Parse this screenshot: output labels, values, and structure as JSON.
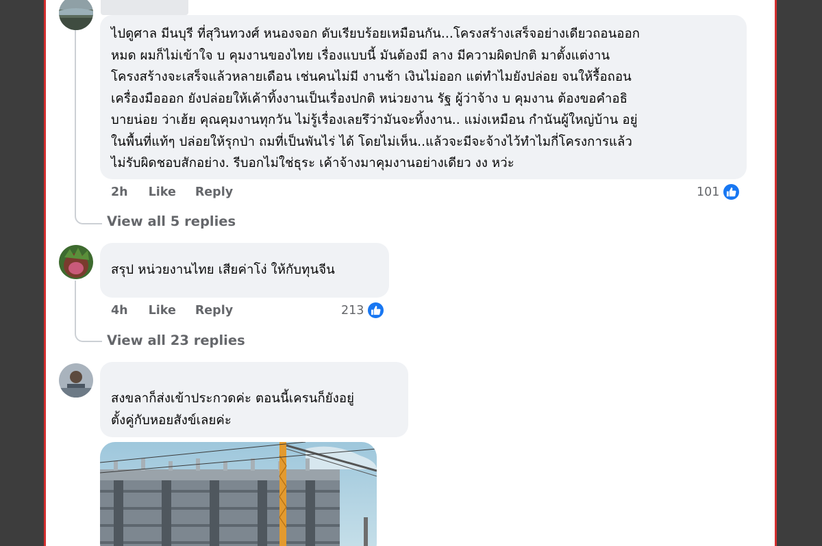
{
  "comments": [
    {
      "text_lines": [
        "ไปดูศาล มีนบุรี ที่สุวินทวงศ์ หนองจอก ดับเรียบร้อยเหมือนกัน...โครงสร้างเสร็จอย่างเดียวถอนออก",
        "หมด ผมก็ไม่เข้าใจ บ คุมงานของไทย เรื่องแบบนี้ มันต้องมี ลาง มีความผิดปกติ มาตั้งแต่งาน",
        "โครงสร้างจะเสร็จแล้วหลายเดือน เช่นคนไม่มี งานช้า เงินไม่ออก แต่ทำไมยังปล่อย จนให้รื้อถอน",
        "เครื่องมือออก ยังปล่อยให้เค้าทิ้งงานเป็นเรื่องปกติ หน่วยงาน รัฐ ผู้ว่าจ้าง บ คุมงาน ต้องขอคำอธิ",
        "บายน่อย ว่าเฮ้ย คุณคุมงานทุกวัน ไม่รู้เรื่องเลยรึว่ามันจะทิ้งงาน.. แม่งเหมือน กำนันผู้ใหญ่บ้าน อยู่",
        "ในพื้นที่แท้ๆ ปล่อยให้รุกป่า ถมที่เป็นพันไร่ ได้ โดยไม่เห็น..แล้วจะมีจะจ้างไว้ทำไมกี่โครงการแล้ว",
        "ไม่รับผิดชอบสักอย่าง. รีบอกไม่ใช่ธุระ เค้าจ้างมาคุมงานอย่างเดียว งง หว่ะ"
      ],
      "time": "2h",
      "like_label": "Like",
      "reply_label": "Reply",
      "reactions": "101",
      "view_replies": "View all 5 replies"
    },
    {
      "text_lines": [
        "สรุป หน่วยงานไทย เสียค่าโง่ ให้กับทุนจีน"
      ],
      "time": "4h",
      "like_label": "Like",
      "reply_label": "Reply",
      "reactions": "213",
      "view_replies": "View all 23 replies"
    },
    {
      "text_lines": [
        "สงขลาก็ส่งเข้าประกวดค่ะ ตอนนี้เครนก็ยังอยู่",
        "ตั้งคู่กับหอยสังข์เลยค่ะ"
      ],
      "photo_icon": "construction-photo"
    }
  ],
  "colors": {
    "accent": "#1877f2",
    "bubble": "#f0f2f5",
    "meta_text": "#65676b",
    "frame_border": "#d32f2f"
  }
}
